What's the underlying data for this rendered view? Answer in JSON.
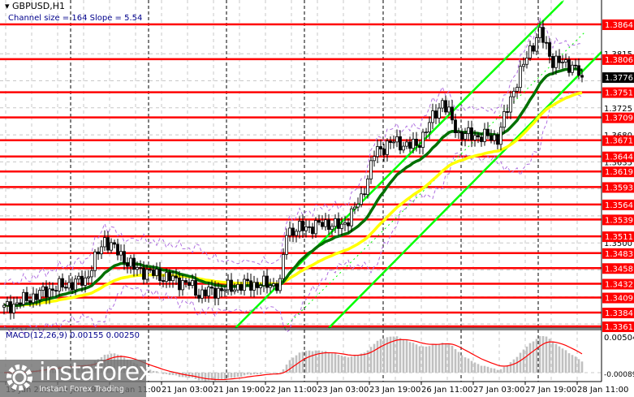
{
  "header": {
    "symbol": "GBPUSD,H1",
    "channel_info": "Channel size = 164 Slope = 5.54"
  },
  "macd": {
    "label": "MACD(12,26,9) 0.00155 0.00250",
    "axis_top": "0.00504",
    "axis_bottom": "-0.00089"
  },
  "watermark": {
    "brand": "instaforex",
    "tagline": "Instant Forex Trading"
  },
  "colors": {
    "level": "#ff0000",
    "channel": "#00ff00",
    "ma_fast": "#007000",
    "ma_slow": "#ffff00",
    "macd_hist": "#c0c0c0",
    "macd_signal": "#ff0000"
  },
  "chart_data": {
    "type": "candlestick",
    "title": "GBPUSD,H1",
    "ylim": [
      1.3361,
      1.3864
    ],
    "current_price": "1.3776",
    "levels": [
      "1.3864",
      "1.3806",
      "1.3751",
      "1.3709",
      "1.3671",
      "1.3644",
      "1.3619",
      "1.3593",
      "1.3564",
      "1.3539",
      "1.3511",
      "1.3483",
      "1.3458",
      "1.3432",
      "1.3409",
      "1.3384",
      "1.3361"
    ],
    "price_ticks": [
      "1.3815",
      "1.3725",
      "1.3680",
      "1.3635",
      "1.3500"
    ],
    "time_labels": [
      "19 Jan 2026",
      "19 Jan 19:00",
      "20 Jan 11:00",
      "21 Jan 03:00",
      "21 Jan 19:00",
      "22 Jan 11:00",
      "23 Jan 03:00",
      "23 Jan 19:00",
      "26 Jan 11:00",
      "27 Jan 03:00",
      "27 Jan 19:00",
      "28 Jan 11:00"
    ],
    "close_waypoints": [
      [
        0,
        1.3391
      ],
      [
        15,
        1.3424
      ],
      [
        25,
        1.3438
      ],
      [
        31,
        1.3506
      ],
      [
        40,
        1.3458
      ],
      [
        57,
        1.3431
      ],
      [
        60,
        1.3415
      ],
      [
        75,
        1.3431
      ],
      [
        85,
        1.3431
      ],
      [
        87,
        1.3519
      ],
      [
        100,
        1.3533
      ],
      [
        104,
        1.3526
      ],
      [
        110,
        1.3573
      ],
      [
        114,
        1.3648
      ],
      [
        119,
        1.3668
      ],
      [
        127,
        1.3661
      ],
      [
        135,
        1.3736
      ],
      [
        140,
        1.3681
      ],
      [
        152,
        1.3675
      ],
      [
        157,
        1.3756
      ],
      [
        162,
        1.3823
      ],
      [
        165,
        1.385
      ],
      [
        169,
        1.3803
      ],
      [
        175,
        1.3796
      ],
      [
        178,
        1.3776
      ]
    ]
  }
}
